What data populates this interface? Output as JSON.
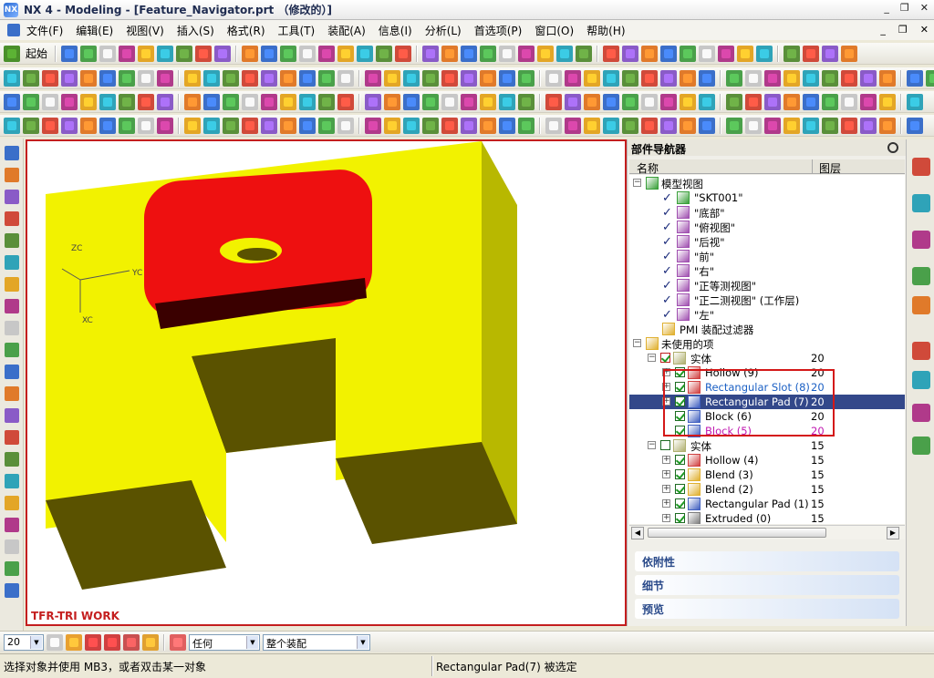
{
  "window": {
    "title": "NX 4 - Modeling - [Feature_Navigator.prt （修改的）]",
    "minimize": "_",
    "restore": "❐",
    "close": "✕"
  },
  "menu": [
    "文件(F)",
    "编辑(E)",
    "视图(V)",
    "插入(S)",
    "格式(R)",
    "工具(T)",
    "装配(A)",
    "信息(I)",
    "分析(L)",
    "首选项(P)",
    "窗口(O)",
    "帮助(H)"
  ],
  "toolbar": {
    "start_label": "起始"
  },
  "viewport": {
    "label": "TFR-TRI WORK",
    "axes": {
      "zc": "ZC",
      "yc": "YC",
      "xc": "XC"
    }
  },
  "navigator": {
    "title": "部件导航器",
    "col_name": "名称",
    "col_layer": "图层",
    "rows": [
      {
        "label": "模型视图",
        "layer": ""
      },
      {
        "label": "\"SKT001\"",
        "layer": ""
      },
      {
        "label": "\"底部\"",
        "layer": ""
      },
      {
        "label": "\"俯视图\"",
        "layer": ""
      },
      {
        "label": "\"后视\"",
        "layer": ""
      },
      {
        "label": "\"前\"",
        "layer": ""
      },
      {
        "label": "\"右\"",
        "layer": ""
      },
      {
        "label": "\"正等测视图\"",
        "layer": ""
      },
      {
        "label": "\"正二测视图\" (工作层)",
        "layer": ""
      },
      {
        "label": "\"左\"",
        "layer": ""
      },
      {
        "label": "PMI 装配过滤器",
        "layer": ""
      },
      {
        "label": "未使用的项",
        "layer": ""
      },
      {
        "label": "实体",
        "layer": "20"
      },
      {
        "label": "Hollow (9)",
        "layer": "20"
      },
      {
        "label": "Rectangular Slot (8)",
        "layer": "20"
      },
      {
        "label": "Rectangular Pad (7)",
        "layer": "20"
      },
      {
        "label": "Block (6)",
        "layer": "20"
      },
      {
        "label": "Block (5)",
        "layer": "20"
      },
      {
        "label": "实体",
        "layer": "15"
      },
      {
        "label": "Hollow (4)",
        "layer": "15"
      },
      {
        "label": "Blend (3)",
        "layer": "15"
      },
      {
        "label": "Blend (2)",
        "layer": "15"
      },
      {
        "label": "Rectangular Pad (1)",
        "layer": "15"
      },
      {
        "label": "Extruded (0)",
        "layer": "15"
      }
    ],
    "panels": [
      "依附性",
      "细节",
      "预览"
    ]
  },
  "bottom": {
    "selection_count": "20",
    "type_filter": "任何",
    "scope": "整个装配"
  },
  "status": {
    "prompt": "选择对象并使用 MB3，或者双击某一对象",
    "selected": "Rectangular Pad(7) 被选定"
  },
  "colors": {
    "highlight_box": "#d41818",
    "selection": "#33488a",
    "slot_label": "#1a5fc4",
    "block5_label": "#c018b0",
    "solid_yellow": "#f2f200",
    "pad_red": "#ee1010"
  }
}
